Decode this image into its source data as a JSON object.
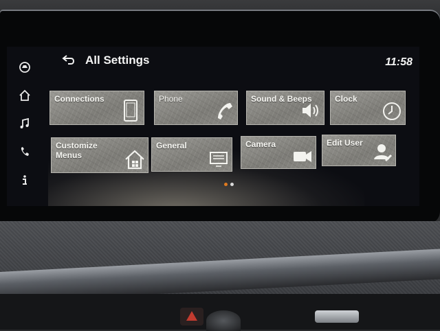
{
  "header": {
    "back_label": "back",
    "title": "All Settings",
    "time": "11:58"
  },
  "sidebar": {
    "items": [
      {
        "name": "assist",
        "icon": "car-assist-icon"
      },
      {
        "name": "home",
        "icon": "home-icon"
      },
      {
        "name": "music",
        "icon": "music-note-icon"
      },
      {
        "name": "phone",
        "icon": "phone-icon"
      },
      {
        "name": "info",
        "icon": "info-icon"
      }
    ]
  },
  "tiles": [
    {
      "label": "Connections",
      "icon": "smartphone-icon"
    },
    {
      "label": "Phone",
      "icon": "phone-handset-icon"
    },
    {
      "label": "Sound & Beeps",
      "icon": "speaker-icon"
    },
    {
      "label": "Clock",
      "icon": "clock-icon"
    },
    {
      "label": "Customize\nMenus",
      "icon": "home-grid-icon"
    },
    {
      "label": "General",
      "icon": "screen-icon"
    },
    {
      "label": "Camera",
      "icon": "camera-icon"
    },
    {
      "label": "Edit User",
      "icon": "user-edit-icon"
    }
  ],
  "pager": {
    "active_index": 0,
    "count": 2,
    "active_color": "#e07a1f"
  },
  "colors": {
    "tile": "#8a8984",
    "screen": "#0c0d12"
  }
}
